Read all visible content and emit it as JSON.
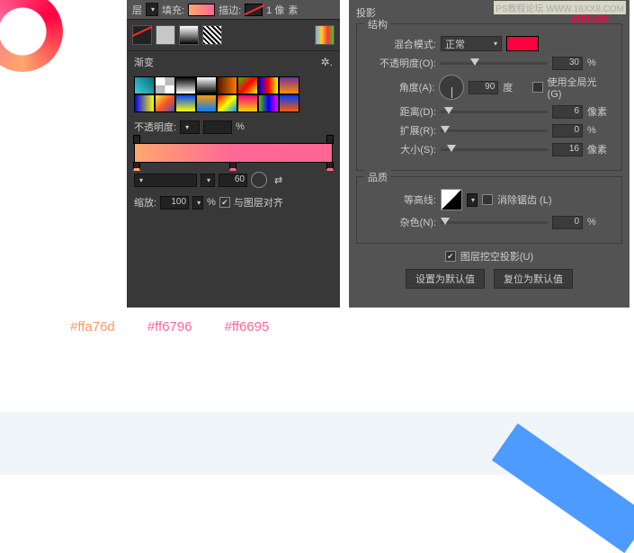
{
  "watermark": "PS教程论坛 WWW.16XX8.COM",
  "left": {
    "toprow": {
      "layer_label": "层",
      "fill_label": "填充:",
      "stroke_label": "描边:",
      "stroke_size": "1 像",
      "stroke_unit": "素"
    },
    "section_gradient": "渐变",
    "opacity_label": "不透明度:",
    "opacity_unit": "%",
    "bottom": {
      "mode_value": "",
      "value": "60"
    },
    "scale": {
      "label": "缩放:",
      "value": "100",
      "unit": "%",
      "align": "与图层对齐"
    }
  },
  "right": {
    "title": "投影",
    "hexnote": "#ff0140",
    "structure": {
      "label": "结构",
      "blend": {
        "label": "混合模式:",
        "value": "正常"
      },
      "opacity": {
        "label": "不透明度(O):",
        "value": "30",
        "unit": "%"
      },
      "angle": {
        "label": "角度(A):",
        "value": "90",
        "unit": "度",
        "global": "使用全局光 (G)"
      },
      "distance": {
        "label": "距离(D):",
        "value": "6",
        "unit": "像素"
      },
      "spread": {
        "label": "扩展(R):",
        "value": "0",
        "unit": "%"
      },
      "size": {
        "label": "大小(S):",
        "value": "16",
        "unit": "像素"
      }
    },
    "quality": {
      "label": "品质",
      "contour": {
        "label": "等高线:",
        "aa": "消除锯齿 (L)"
      },
      "noise": {
        "label": "杂色(N):",
        "value": "0",
        "unit": "%"
      }
    },
    "knockout": "图层挖空投影(U)",
    "buttons": {
      "default": "设置为默认值",
      "reset": "复位为默认值"
    }
  },
  "hexcodes": {
    "c1": "#ffa76d",
    "c2": "#ff6796",
    "c3": "#ff6695"
  },
  "swatch_colors": [
    "linear-gradient(45deg,#39d2d8,#0a6b7a)",
    "repeating-conic-gradient(#bbb 0 25%,#fff 0 50%)",
    "linear-gradient(#000,#fff)",
    "linear-gradient(#fff,#000)",
    "linear-gradient(90deg,#4e1600,#ff7a00)",
    "linear-gradient(135deg,#4b0,#f00,#ff0)",
    "linear-gradient(90deg,#00f,#f00,#ff0)",
    "linear-gradient(#7030a0,#ff8d00)",
    "linear-gradient(90deg,#00f,#ff0)",
    "linear-gradient(135deg,#ffeb3b,#ff5722,#3f51b5)",
    "linear-gradient(#0048ff,#ff0)",
    "linear-gradient(#f90,#007fff)",
    "linear-gradient(135deg,#f00,#ff0,#09f)",
    "linear-gradient(#ff007f,#ffd400)",
    "linear-gradient(90deg,#6b0,#00f,#f0f)",
    "linear-gradient(#003cff,#ff5a00)"
  ]
}
